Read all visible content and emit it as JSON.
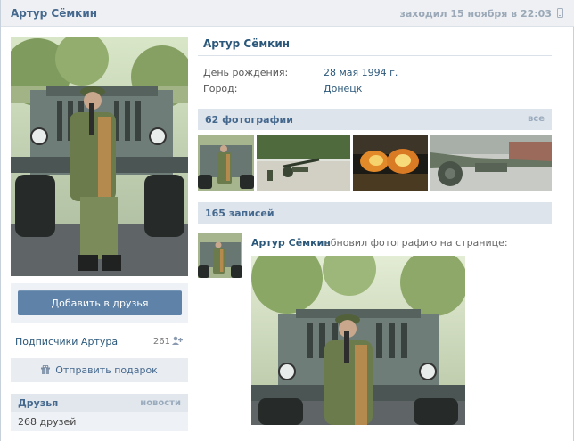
{
  "header": {
    "name": "Артур Сёмкин",
    "last_seen": "заходил 15 ноября в 22:03"
  },
  "profile": {
    "name": "Артур Сёмкин",
    "info": [
      {
        "label": "День рождения:",
        "value": "28 мая 1994 г."
      },
      {
        "label": "Город:",
        "value": "Донецк"
      }
    ]
  },
  "actions": {
    "add_friend": "Добавить в друзья",
    "send_gift": "Отправить подарок"
  },
  "subscribers": {
    "label": "Подписчики Артура",
    "count": "261"
  },
  "friends": {
    "title": "Друзья",
    "news_link": "новости",
    "count_text": "268 друзей"
  },
  "photos": {
    "title": "62 фотографии",
    "all_link": "все"
  },
  "wall": {
    "title": "165 записей",
    "post": {
      "author": "Артур Сёмкин",
      "action": "обновил фотографию на странице:"
    }
  },
  "colors": {
    "link": "#2b587a",
    "section_bg": "#dde4ec",
    "button": "#5e82a8"
  },
  "icons": [
    "phone-icon",
    "subscribers-icon",
    "gift-icon"
  ]
}
